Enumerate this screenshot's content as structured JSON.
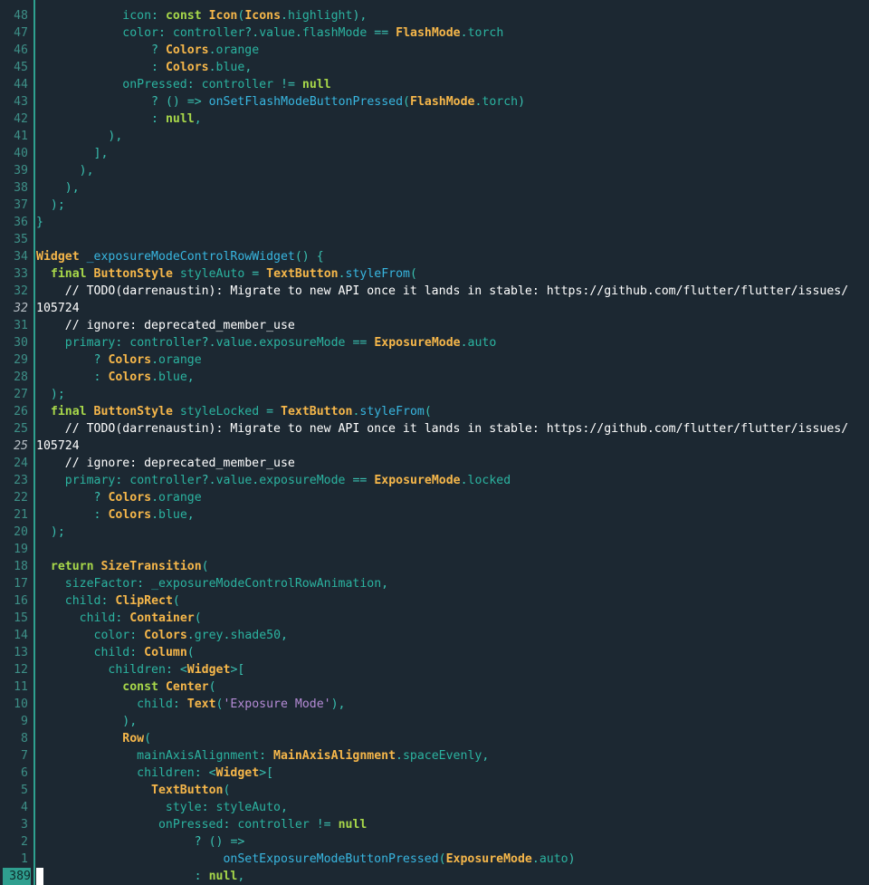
{
  "editor": {
    "lines": [
      {
        "gutter": "48",
        "text": "            icon: const Icon(Icons.highlight),"
      },
      {
        "gutter": "47",
        "text": "            color: controller?.value.flashMode == FlashMode.torch"
      },
      {
        "gutter": "46",
        "text": "                ? Colors.orange"
      },
      {
        "gutter": "45",
        "text": "                : Colors.blue,"
      },
      {
        "gutter": "44",
        "text": "            onPressed: controller != null"
      },
      {
        "gutter": "43",
        "text": "                ? () => onSetFlashModeButtonPressed(FlashMode.torch)"
      },
      {
        "gutter": "42",
        "text": "                : null,"
      },
      {
        "gutter": "41",
        "text": "          ),"
      },
      {
        "gutter": "40",
        "text": "        ],"
      },
      {
        "gutter": "39",
        "text": "      ),"
      },
      {
        "gutter": "38",
        "text": "    ),"
      },
      {
        "gutter": "37",
        "text": "  );"
      },
      {
        "gutter": "36",
        "text": "}"
      },
      {
        "gutter": "35",
        "text": ""
      },
      {
        "gutter": "34",
        "text": "Widget _exposureModeControlRowWidget() {"
      },
      {
        "gutter": "33",
        "text": "  final ButtonStyle styleAuto = TextButton.styleFrom("
      },
      {
        "gutter": "32",
        "text": "    // TODO(darrenaustin): Migrate to new API once it lands in stable: https://github.com/flutter/flutter/issues/"
      },
      {
        "gutter": "32",
        "text": "105724",
        "wrap": true
      },
      {
        "gutter": "31",
        "text": "    // ignore: deprecated_member_use"
      },
      {
        "gutter": "30",
        "text": "    primary: controller?.value.exposureMode == ExposureMode.auto"
      },
      {
        "gutter": "29",
        "text": "        ? Colors.orange"
      },
      {
        "gutter": "28",
        "text": "        : Colors.blue,"
      },
      {
        "gutter": "27",
        "text": "  );"
      },
      {
        "gutter": "26",
        "text": "  final ButtonStyle styleLocked = TextButton.styleFrom("
      },
      {
        "gutter": "25",
        "text": "    // TODO(darrenaustin): Migrate to new API once it lands in stable: https://github.com/flutter/flutter/issues/"
      },
      {
        "gutter": "25",
        "text": "105724",
        "wrap": true
      },
      {
        "gutter": "24",
        "text": "    // ignore: deprecated_member_use"
      },
      {
        "gutter": "23",
        "text": "    primary: controller?.value.exposureMode == ExposureMode.locked"
      },
      {
        "gutter": "22",
        "text": "        ? Colors.orange"
      },
      {
        "gutter": "21",
        "text": "        : Colors.blue,"
      },
      {
        "gutter": "20",
        "text": "  );"
      },
      {
        "gutter": "19",
        "text": ""
      },
      {
        "gutter": "18",
        "text": "  return SizeTransition("
      },
      {
        "gutter": "17",
        "text": "    sizeFactor: _exposureModeControlRowAnimation,"
      },
      {
        "gutter": "16",
        "text": "    child: ClipRect("
      },
      {
        "gutter": "15",
        "text": "      child: Container("
      },
      {
        "gutter": "14",
        "text": "        color: Colors.grey.shade50,"
      },
      {
        "gutter": "13",
        "text": "        child: Column("
      },
      {
        "gutter": "12",
        "text": "          children: <Widget>["
      },
      {
        "gutter": "11",
        "text": "            const Center("
      },
      {
        "gutter": "10",
        "text": "              child: Text('Exposure Mode'),"
      },
      {
        "gutter": "9",
        "text": "            ),"
      },
      {
        "gutter": "8",
        "text": "            Row("
      },
      {
        "gutter": "7",
        "text": "              mainAxisAlignment: MainAxisAlignment.spaceEvenly,"
      },
      {
        "gutter": "6",
        "text": "              children: <Widget>["
      },
      {
        "gutter": "5",
        "text": "                TextButton("
      },
      {
        "gutter": "4",
        "text": "                  style: styleAuto,"
      },
      {
        "gutter": "3",
        "text": "                 onPressed: controller != null"
      },
      {
        "gutter": "2",
        "text": "                      ? () =>"
      },
      {
        "gutter": "1",
        "text": "                          onSetExposureModeButtonPressed(ExposureMode.auto)"
      },
      {
        "gutter": "389",
        "text": "                      : null,",
        "current": true
      }
    ]
  }
}
